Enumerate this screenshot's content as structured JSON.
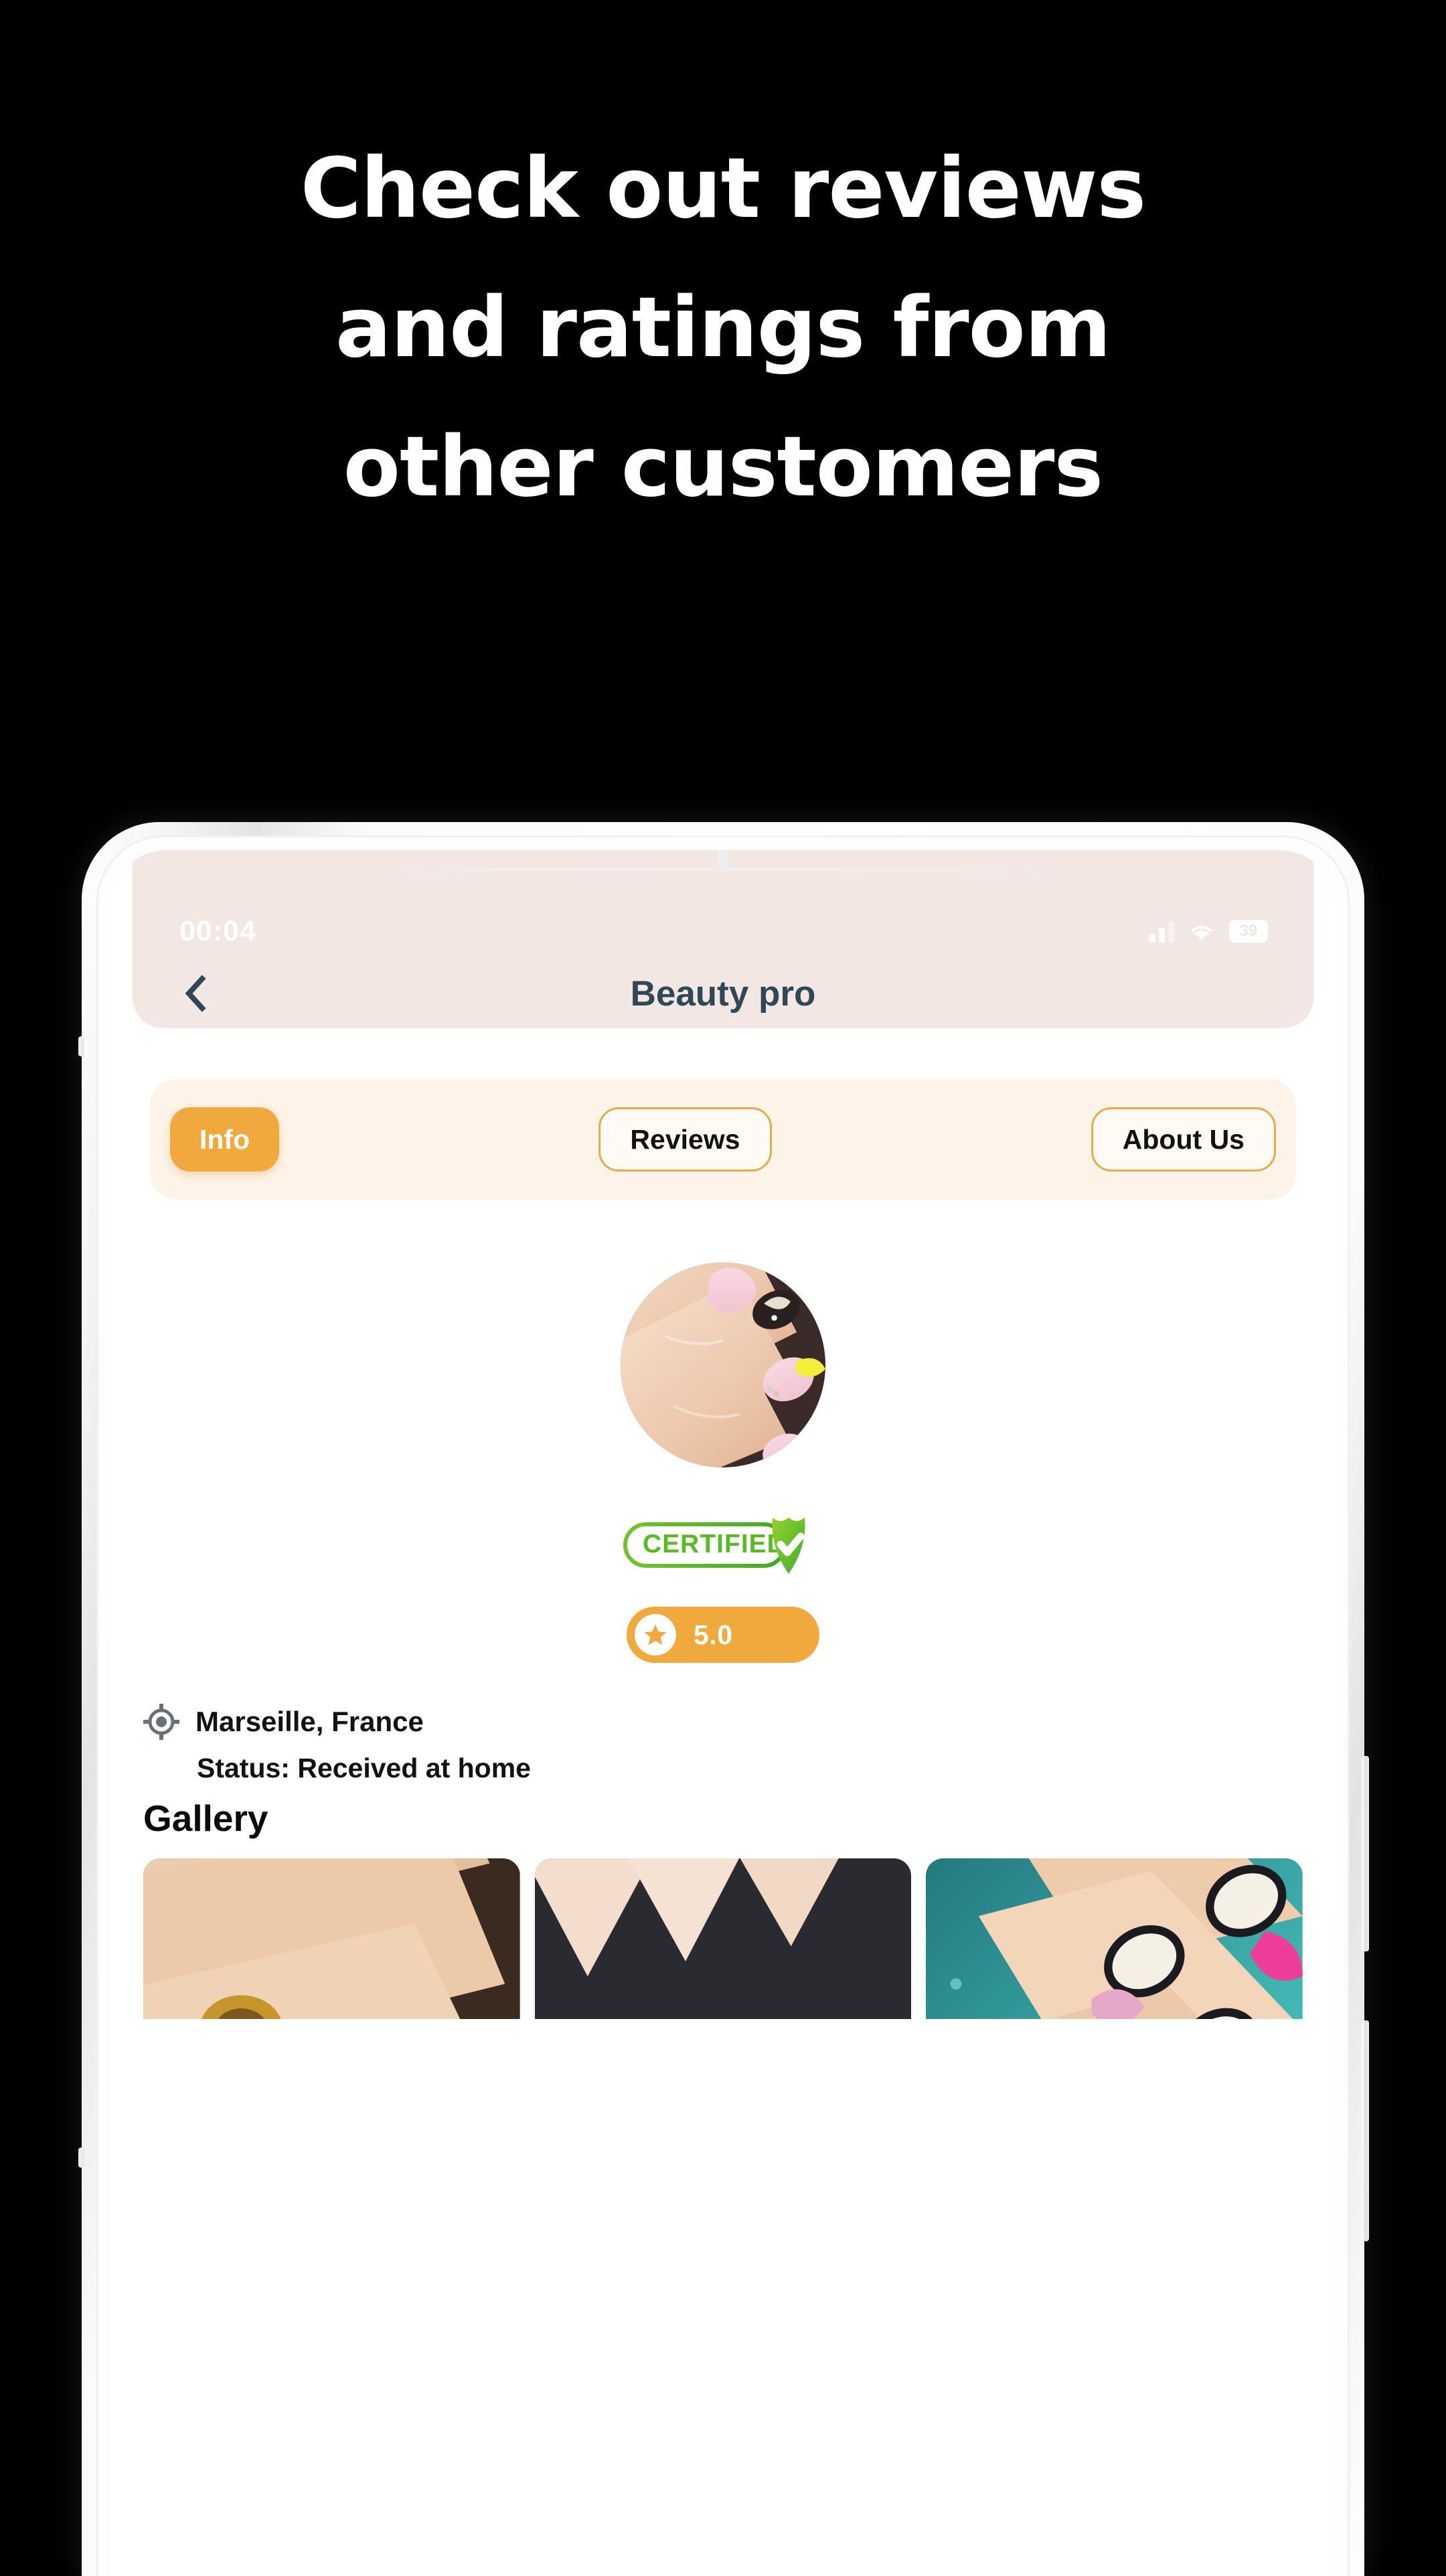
{
  "promo": {
    "headline_lines": [
      "Check out reviews",
      "and ratings from",
      "other customers"
    ]
  },
  "colors": {
    "background": "#000000",
    "headline_text": "#ffffff",
    "accent_orange": "#f0a93c",
    "tabbar_bg": "#fdf3e8",
    "header_pink": "#f2e7e3",
    "title_slate": "#2f4858",
    "certified_green": "#5bb827",
    "screen_bg": "#ffffff"
  },
  "phone": {
    "status_bar": {
      "time": "00:04",
      "signal_icon": "signal-bars-icon",
      "wifi_icon": "wifi-icon",
      "battery_icon": "battery-icon",
      "battery_level": "39"
    },
    "app_bar": {
      "back_icon": "chevron-left-icon",
      "title": "Beauty pro"
    },
    "tabs": [
      {
        "label": "Info",
        "active": true
      },
      {
        "label": "Reviews",
        "active": false
      },
      {
        "label": "About Us",
        "active": false
      }
    ],
    "profile": {
      "avatar_alt": "nail-art-avatar",
      "certified_label": "CERTIFIED",
      "certified_icon": "shield-check-icon",
      "rating_icon": "star-icon",
      "rating_value": "5.0"
    },
    "details": {
      "location_icon": "crosshair-location-icon",
      "location": "Marseille, France",
      "status": "Status: Received at home"
    },
    "gallery": {
      "title": "Gallery",
      "items": [
        {
          "alt": "hand-with-gold-ring-pink-nails"
        },
        {
          "alt": "neon-drip-black-nails"
        },
        {
          "alt": "cartoon-art-nails-on-teal-glitter"
        }
      ]
    }
  }
}
